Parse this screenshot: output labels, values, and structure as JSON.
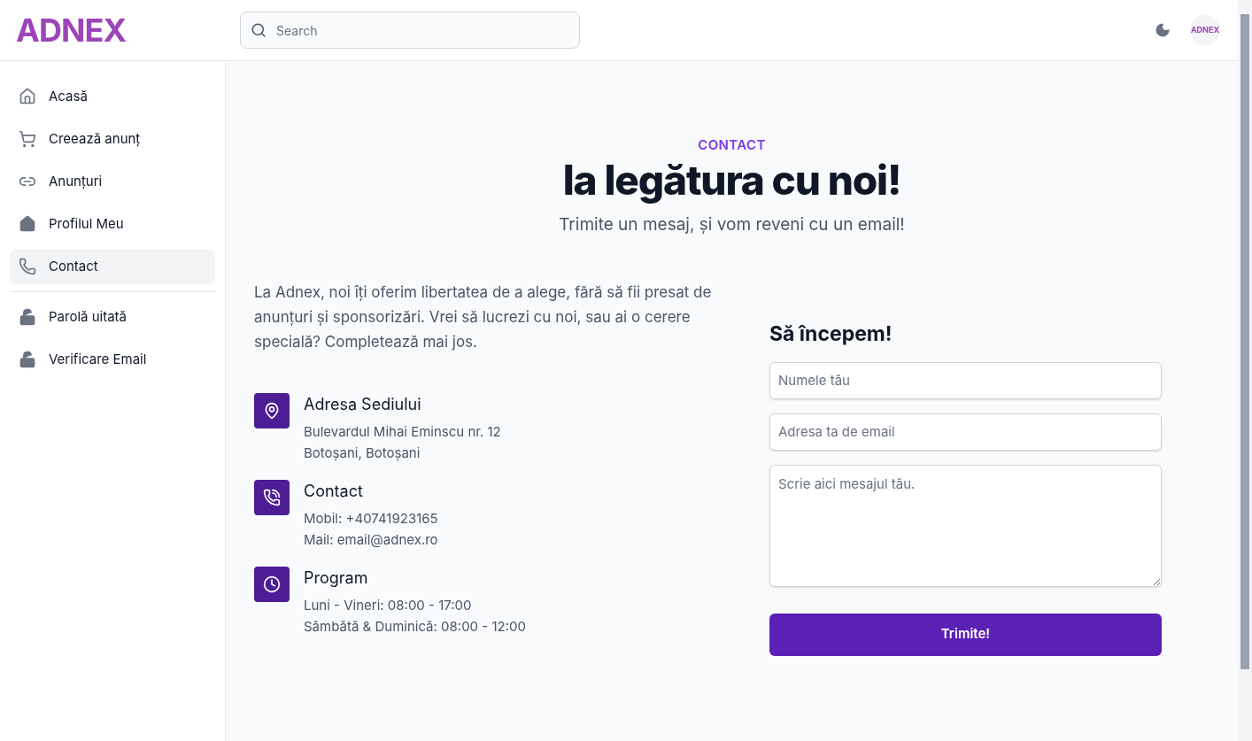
{
  "header": {
    "logo": "ADNEX",
    "search": {
      "placeholder": "Search"
    },
    "avatar": "ADNEX"
  },
  "sidebar": {
    "items": [
      {
        "label": "Acasă",
        "selected": false
      },
      {
        "label": "Creează anunț",
        "selected": false
      },
      {
        "label": "Anunțuri",
        "selected": false
      },
      {
        "label": "Profilul Meu",
        "selected": false
      },
      {
        "label": "Contact",
        "selected": true
      }
    ],
    "secondary_items": [
      {
        "label": "Parolă uitată"
      },
      {
        "label": "Verificare Email"
      }
    ]
  },
  "hero": {
    "eyebrow": "CONTACT",
    "title": "la legătura cu noi!",
    "subtitle": "Trimite un mesaj, și vom reveni cu un email!"
  },
  "intro": "La Adnex, noi îți oferim libertatea de a alege, fără să fii presat de anunțuri și sponsorizări. Vrei să lucrezi cu noi, sau ai o cerere specială? Completează mai jos.",
  "info": [
    {
      "kind": "location",
      "title": "Adresa Sediului",
      "lines": [
        "Bulevardul Mihai Eminscu nr. 12",
        "Botoșani, Botoșani"
      ]
    },
    {
      "kind": "phone",
      "title": "Contact",
      "lines": [
        "Mobil: +40741923165",
        "Mail: email@adnex.ro"
      ]
    },
    {
      "kind": "clock",
      "title": "Program",
      "lines": [
        "Luni - Vineri: 08:00 - 17:00",
        "Sâmbătă & Duminică: 08:00 - 12:00"
      ]
    }
  ],
  "form": {
    "title": "Să începem!",
    "name": {
      "placeholder": "Numele tău"
    },
    "email": {
      "placeholder": "Adresa ta de email"
    },
    "message": {
      "placeholder": "Scrie aici mesajul tău."
    },
    "submit": "Trimite!"
  }
}
